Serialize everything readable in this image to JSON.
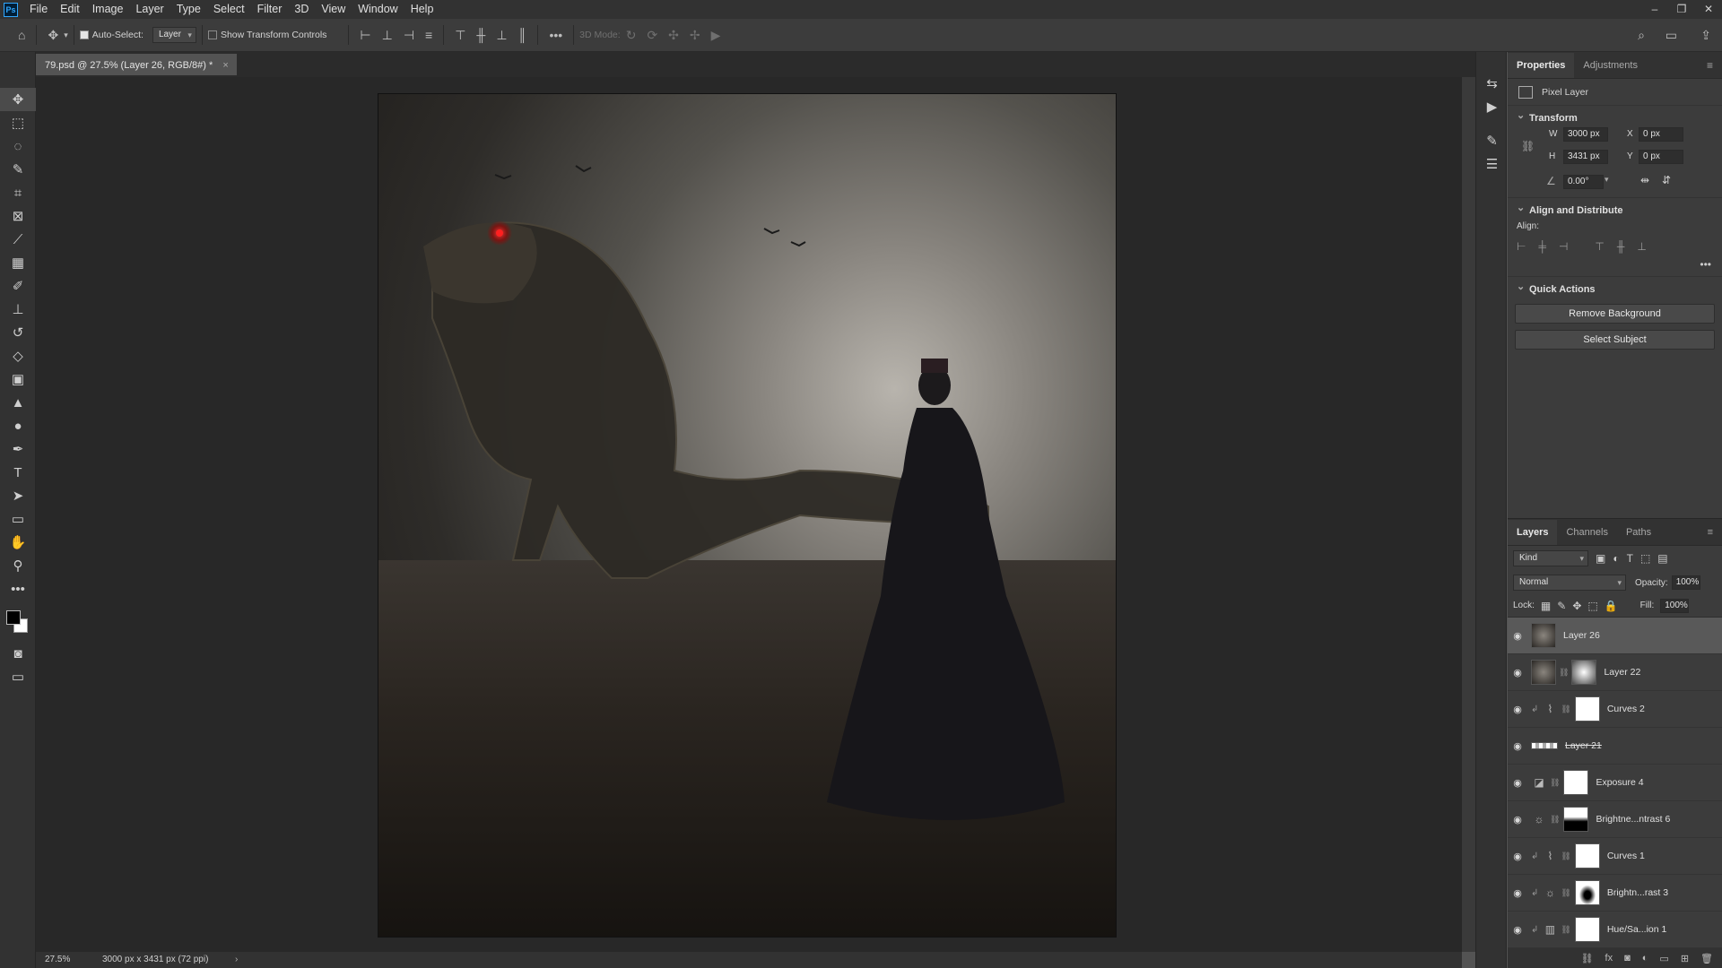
{
  "app": {
    "logo": "Ps",
    "menus": [
      "File",
      "Edit",
      "Image",
      "Layer",
      "Type",
      "Select",
      "Filter",
      "3D",
      "View",
      "Window",
      "Help"
    ]
  },
  "options": {
    "auto_select_label": "Auto-Select:",
    "auto_select_value": "Layer",
    "show_transform_label": "Show Transform Controls",
    "mode3d_label": "3D Mode:"
  },
  "document": {
    "tab_title": "79.psd @ 27.5% (Layer 26, RGB/8#) *",
    "zoom": "27.5%",
    "dimensions": "3000 px x 3431 px (72 ppi)"
  },
  "properties": {
    "tabs": [
      "Properties",
      "Adjustments"
    ],
    "layer_type": "Pixel Layer",
    "transform_title": "Transform",
    "w_label": "W",
    "w": "3000 px",
    "x_label": "X",
    "x": "0 px",
    "h_label": "H",
    "h": "3431 px",
    "y_label": "Y",
    "y": "0 px",
    "angle": "0.00°",
    "align_title": "Align and Distribute",
    "align_label": "Align:",
    "quick_title": "Quick Actions",
    "remove_bg": "Remove Background",
    "select_subject": "Select Subject"
  },
  "layers_panel": {
    "tabs": [
      "Layers",
      "Channels",
      "Paths"
    ],
    "kind": "Kind",
    "blend": "Normal",
    "opacity_label": "Opacity:",
    "opacity": "100%",
    "lock_label": "Lock:",
    "fill_label": "Fill:",
    "fill": "100%",
    "layers": [
      {
        "name": "Layer 26"
      },
      {
        "name": "Layer 22"
      },
      {
        "name": "Curves 2"
      },
      {
        "name": "Layer 21"
      },
      {
        "name": "Exposure 4"
      },
      {
        "name": "Brightne...ntrast 6"
      },
      {
        "name": "Curves 1"
      },
      {
        "name": "Brightn...rast 3"
      },
      {
        "name": "Hue/Sa...ion 1"
      }
    ]
  }
}
